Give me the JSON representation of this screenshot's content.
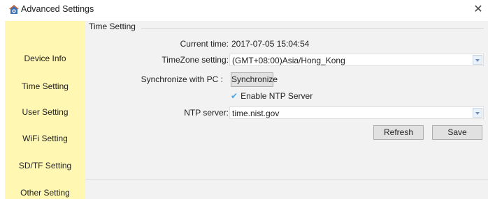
{
  "window": {
    "title": "Advanced Settings",
    "close_glyph": "✕",
    "icon": "house-gear-icon"
  },
  "sidebar": {
    "items": [
      {
        "label": "Device Info"
      },
      {
        "label": "Time Setting"
      },
      {
        "label": "User Setting"
      },
      {
        "label": "WiFi Setting"
      },
      {
        "label": "SD/TF Setting"
      },
      {
        "label": "Other Setting"
      }
    ]
  },
  "time_setting": {
    "group_title": "Time Setting",
    "current_time_label": "Current time:",
    "current_time_value": "2017-07-05 15:04:54",
    "timezone_label": "TimeZone setting:",
    "timezone_value": "(GMT+08:00)Asia/Hong_Kong",
    "sync_label": "Synchronize with PC :",
    "sync_button": "Synchronize",
    "ntp_enable_label": "Enable NTP Server",
    "ntp_enabled": true,
    "ntp_server_label": "NTP server:",
    "ntp_server_value": "time.nist.gov",
    "refresh_button": "Refresh",
    "save_button": "Save"
  },
  "colors": {
    "sidebar_bg": "#fff7b2",
    "panel_bg": "#f2f2f2",
    "check_accent": "#4aa3e8"
  }
}
